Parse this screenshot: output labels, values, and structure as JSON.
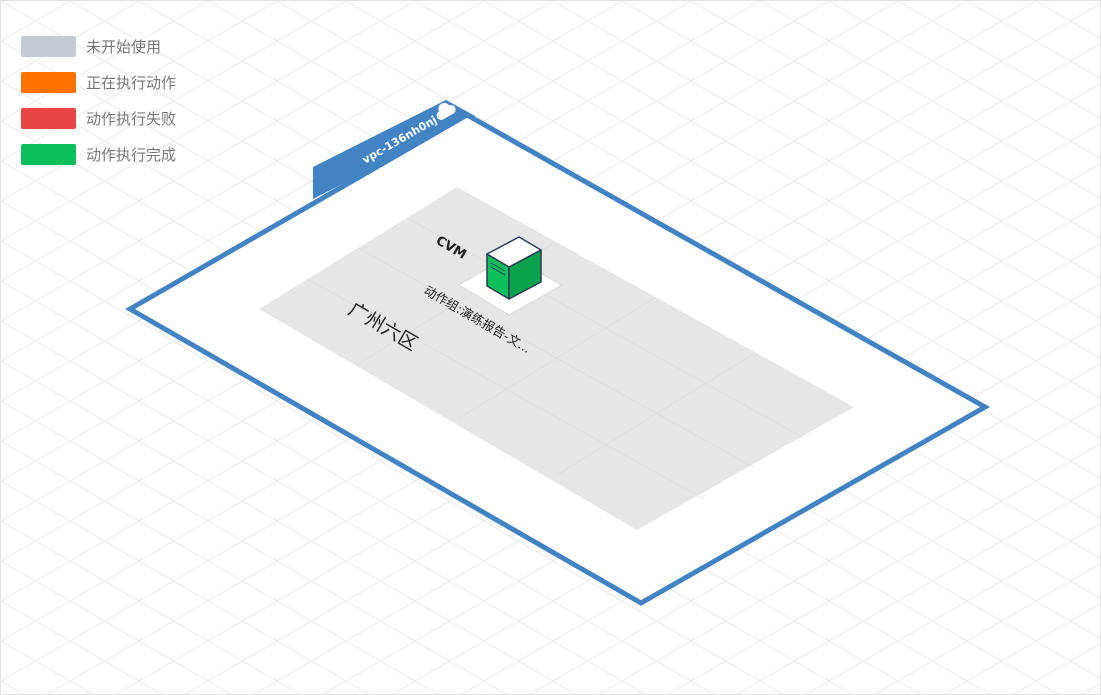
{
  "legend": [
    {
      "label": "未开始使用",
      "color": "#c5cbd3"
    },
    {
      "label": "正在执行动作",
      "color": "#ff7200"
    },
    {
      "label": "动作执行失败",
      "color": "#e84545"
    },
    {
      "label": "动作执行完成",
      "color": "#0cbf5b"
    }
  ],
  "vpc": {
    "name": "vpc-136nh0nj",
    "border_color": "#4283c4",
    "icon": "cloud-icon"
  },
  "zone": {
    "name": "广州六区",
    "fill_color": "#e2e2e2"
  },
  "node": {
    "type_label": "CVM",
    "action_group": "动作组:演练报告-文...",
    "status_color": "#0cbf5b",
    "icon": "server-icon"
  }
}
